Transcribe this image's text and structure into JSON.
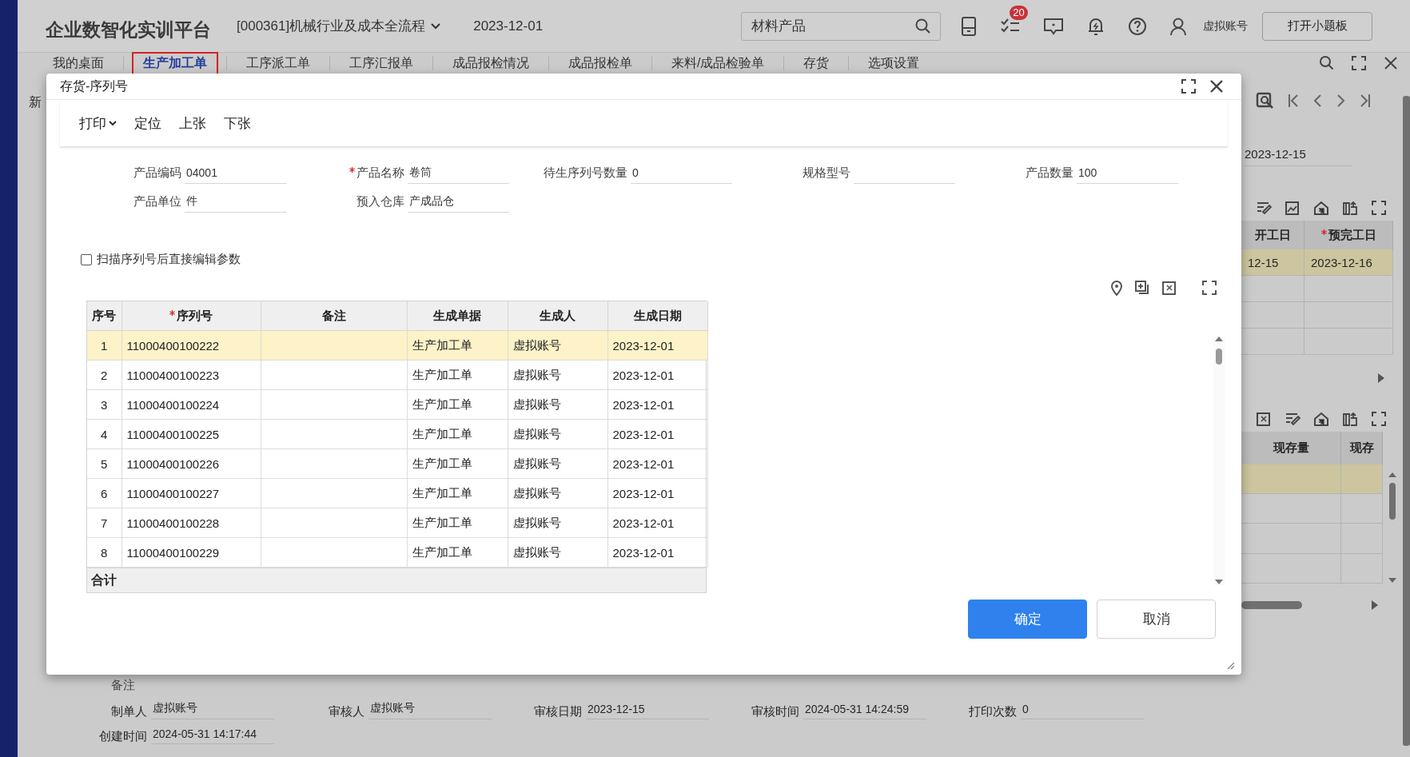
{
  "header": {
    "title": "企业数智化实训平台",
    "company": "[000361]机械行业及成本全流程",
    "date": "2023-12-01",
    "search": {
      "value": "材料产品"
    },
    "task_badge": "20",
    "user": "虚拟账号",
    "board_button": "打开小题板"
  },
  "tabs": [
    {
      "label": "我的桌面",
      "selected": false
    },
    {
      "label": "生产加工单",
      "selected": true
    },
    {
      "label": "工序派工单",
      "selected": false
    },
    {
      "label": "工序汇报单",
      "selected": false
    },
    {
      "label": "成品报检情况",
      "selected": false
    },
    {
      "label": "成品报检单",
      "selected": false
    },
    {
      "label": "来料/成品检验单",
      "selected": false
    },
    {
      "label": "存货",
      "selected": false
    },
    {
      "label": "选项设置",
      "selected": false
    }
  ],
  "page_fragment": "新",
  "right_panel": {
    "date": "2023-12-15",
    "schedule_table": {
      "columns": [
        {
          "label": "开工日",
          "required": false
        },
        {
          "label": "预完工日",
          "required": true
        }
      ],
      "rows": [
        {
          "cells": [
            "12-15",
            "2023-12-16"
          ],
          "selected": true
        }
      ]
    },
    "stock_table": {
      "columns": [
        {
          "label": "现存量",
          "required": false
        },
        {
          "label": "现存",
          "required": false
        }
      ],
      "rows": [
        {
          "cells": [],
          "selected": true
        }
      ]
    }
  },
  "record": {
    "remark_label": "备注",
    "fields": [
      {
        "label": "制单人",
        "value": "虚拟账号"
      },
      {
        "label": "审核人",
        "value": "虚拟账号"
      },
      {
        "label": "审核日期",
        "value": "2023-12-15"
      },
      {
        "label": "审核时间",
        "value": "2024-05-31 14:24:59"
      },
      {
        "label": "打印次数",
        "value": "0"
      },
      {
        "label": "创建时间",
        "value": "2024-05-31 14:17:44"
      }
    ]
  },
  "modal": {
    "title": "存货-序列号",
    "toolbar": [
      {
        "label": "打印",
        "kind": "dropdown"
      },
      {
        "label": "定位",
        "kind": "button"
      },
      {
        "label": "上张",
        "kind": "button"
      },
      {
        "label": "下张",
        "kind": "button"
      }
    ],
    "fields": [
      {
        "label": "产品编码",
        "value": "04001",
        "required": false
      },
      {
        "label": "产品名称",
        "value": "卷筒",
        "required": true
      },
      {
        "label": "待生序列号数量",
        "value": "0",
        "required": false
      },
      {
        "label": "规格型号",
        "required": false
      },
      {
        "label": "产品数量",
        "value": "100",
        "required": false
      },
      {
        "label": "产品单位",
        "value": "件",
        "required": false
      },
      {
        "label": "预入仓库",
        "value": "产成品仓",
        "required": false
      }
    ],
    "scan_option": {
      "label": "扫描序列号后直接编辑参数",
      "checked": false
    },
    "table": {
      "columns": [
        {
          "label": "序号",
          "required": false
        },
        {
          "label": "序列号",
          "required": true
        },
        {
          "label": "备注",
          "required": false
        },
        {
          "label": "生成单据",
          "required": false
        },
        {
          "label": "生成人",
          "required": false
        },
        {
          "label": "生成日期",
          "required": false
        }
      ],
      "rows": [
        {
          "index": "1",
          "serial": "11000400100222",
          "source": "生产加工单",
          "creator": "虚拟账号",
          "date": "2023-12-01",
          "selected": true
        },
        {
          "index": "2",
          "serial": "11000400100223",
          "source": "生产加工单",
          "creator": "虚拟账号",
          "date": "2023-12-01",
          "selected": false
        },
        {
          "index": "3",
          "serial": "11000400100224",
          "source": "生产加工单",
          "creator": "虚拟账号",
          "date": "2023-12-01",
          "selected": false
        },
        {
          "index": "4",
          "serial": "11000400100225",
          "source": "生产加工单",
          "creator": "虚拟账号",
          "date": "2023-12-01",
          "selected": false
        },
        {
          "index": "5",
          "serial": "11000400100226",
          "source": "生产加工单",
          "creator": "虚拟账号",
          "date": "2023-12-01",
          "selected": false
        },
        {
          "index": "6",
          "serial": "11000400100227",
          "source": "生产加工单",
          "creator": "虚拟账号",
          "date": "2023-12-01",
          "selected": false
        },
        {
          "index": "7",
          "serial": "11000400100228",
          "source": "生产加工单",
          "creator": "虚拟账号",
          "date": "2023-12-01",
          "selected": false
        },
        {
          "index": "8",
          "serial": "11000400100229",
          "source": "生产加工单",
          "creator": "虚拟账号",
          "date": "2023-12-01",
          "selected": false
        }
      ],
      "footer": "合计"
    },
    "buttons": [
      {
        "label": "确定",
        "kind": "primary"
      },
      {
        "label": "取消",
        "kind": "secondary"
      }
    ]
  }
}
